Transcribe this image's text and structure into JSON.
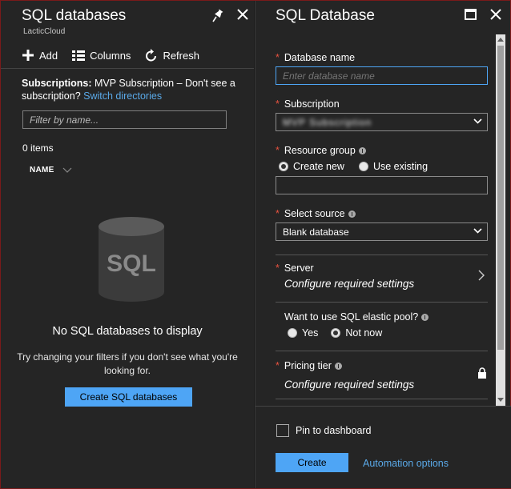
{
  "left_blade": {
    "title": "SQL databases",
    "subtitle": "LacticCloud",
    "toolbar": {
      "add": "Add",
      "columns": "Columns",
      "refresh": "Refresh"
    },
    "subscriptions": {
      "label": "Subscriptions:",
      "value": " MVP Subscription – Don't see a subscription? ",
      "link": "Switch directories"
    },
    "filter_placeholder": "Filter by name...",
    "items_count": "0 items",
    "column_header": "NAME",
    "empty_art_label": "SQL",
    "empty_title": "No SQL databases to display",
    "empty_message": "Try changing your filters if you don't see what you're looking for.",
    "create_button": "Create SQL databases"
  },
  "right_blade": {
    "title": "SQL Database",
    "database_name": {
      "label": "Database name",
      "placeholder": "Enter database name"
    },
    "subscription": {
      "label": "Subscription",
      "value": "MVP Subscription"
    },
    "resource_group": {
      "label": "Resource group",
      "options": [
        "Create new",
        "Use existing"
      ],
      "selected": "Create new",
      "value": ""
    },
    "select_source": {
      "label": "Select source",
      "value": "Blank database"
    },
    "server": {
      "label": "Server",
      "value": "Configure required settings"
    },
    "elastic_pool": {
      "label": "Want to use SQL elastic pool?",
      "options": [
        "Yes",
        "Not now"
      ],
      "selected": "Not now"
    },
    "pricing_tier": {
      "label": "Pricing tier",
      "value": "Configure required settings"
    },
    "footer": {
      "pin_label": "Pin to dashboard",
      "create_button": "Create",
      "automation_link": "Automation options"
    }
  },
  "colors": {
    "accent": "#4ea5f5",
    "required": "#e8523f",
    "link": "#5aa9e8",
    "blade_bg": "#252525"
  }
}
